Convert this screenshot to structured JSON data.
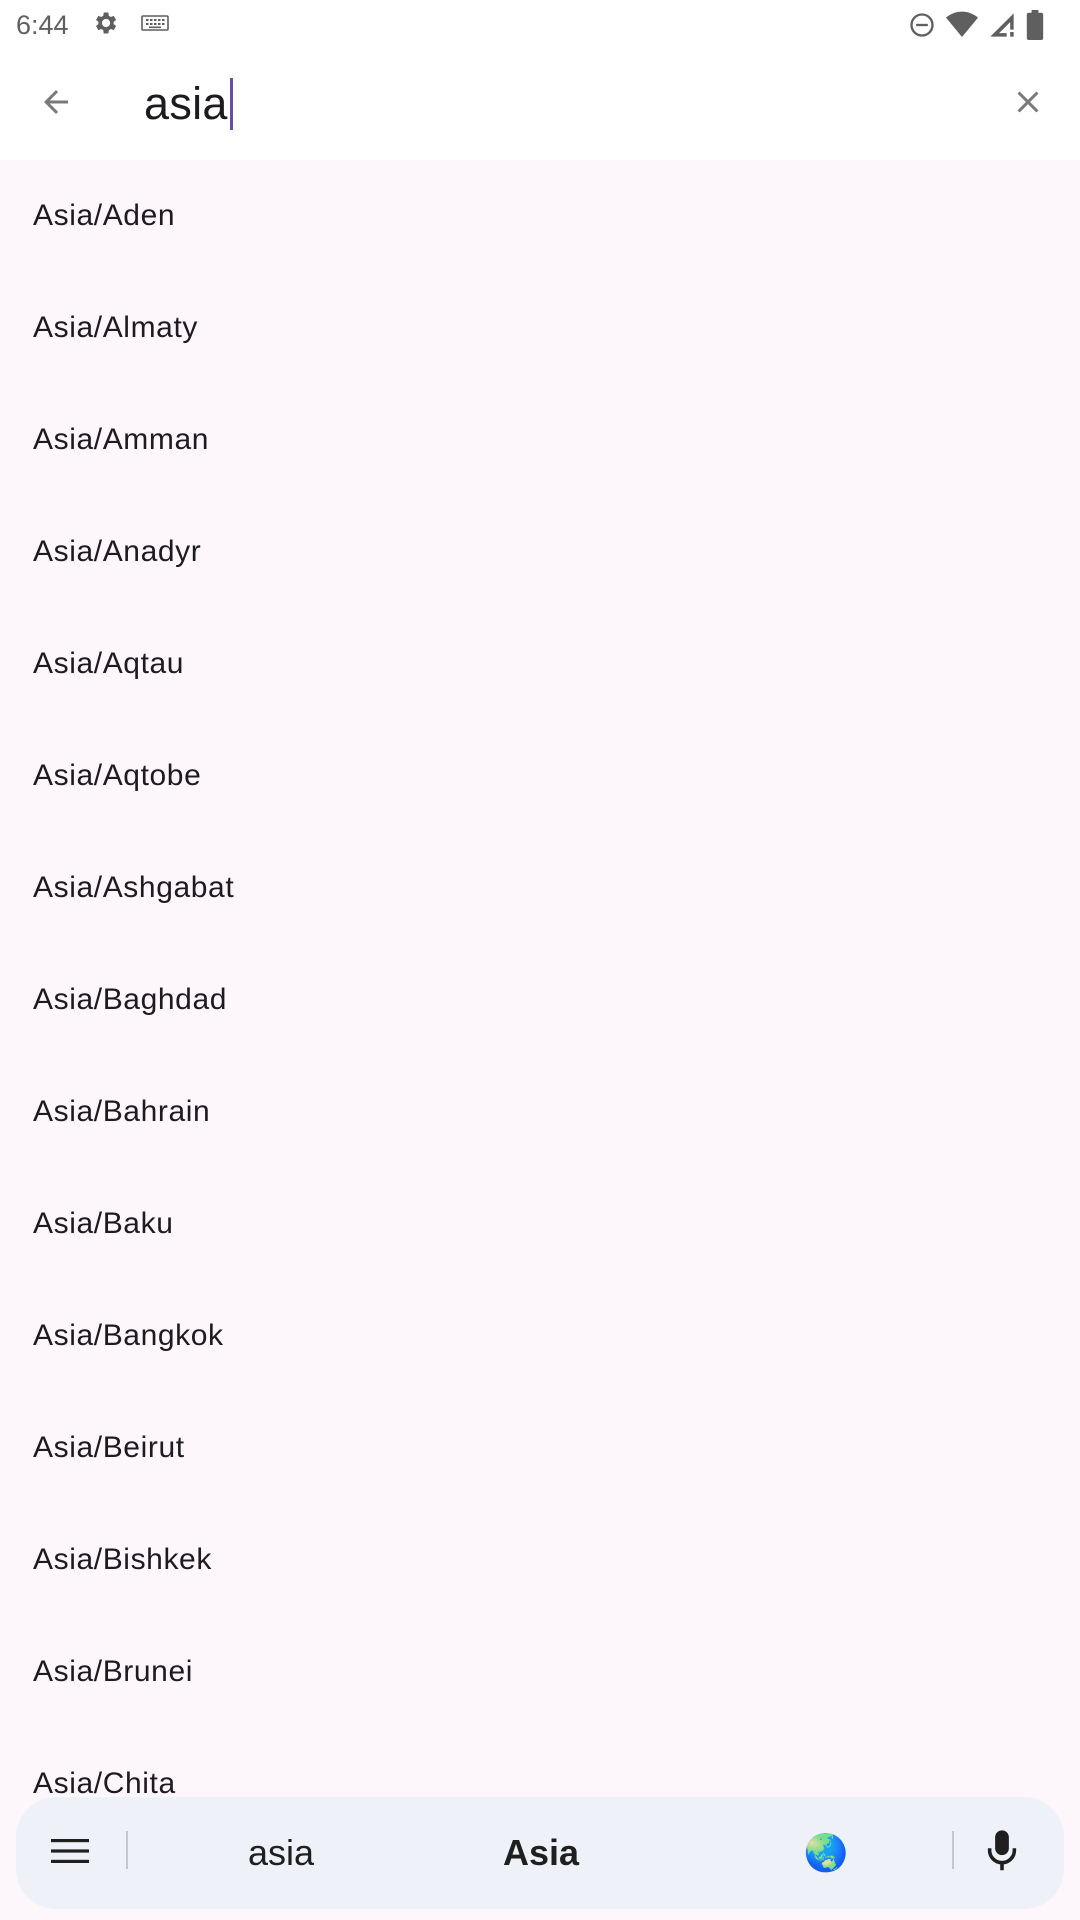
{
  "status_bar": {
    "time": "6:44",
    "icons": [
      "settings-icon",
      "keyboard-icon",
      "do-not-disturb-icon",
      "wifi-icon",
      "signal-icon",
      "battery-icon"
    ]
  },
  "search": {
    "query": "asia",
    "back_icon": "arrow-back-icon",
    "clear_icon": "close-icon",
    "caret_color": "#6750a4"
  },
  "results": [
    "Asia/Aden",
    "Asia/Almaty",
    "Asia/Amman",
    "Asia/Anadyr",
    "Asia/Aqtau",
    "Asia/Aqtobe",
    "Asia/Ashgabat",
    "Asia/Baghdad",
    "Asia/Bahrain",
    "Asia/Baku",
    "Asia/Bangkok",
    "Asia/Beirut",
    "Asia/Bishkek",
    "Asia/Brunei",
    "Asia/Chita"
  ],
  "keyboard_suggestions": {
    "menu_icon": "menu-icon",
    "items": [
      "asia",
      "Asia",
      "🌏"
    ],
    "mic_icon": "mic-icon"
  },
  "colors": {
    "background": "#fdf7fb",
    "toolbar": "#ffffff",
    "text": "#1d1b20",
    "suggestion_strip": "#eef2f8"
  }
}
